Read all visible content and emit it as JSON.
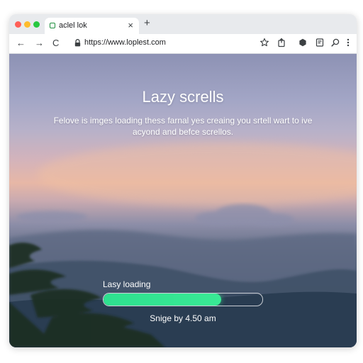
{
  "browser": {
    "tab": {
      "title": "aclel lok",
      "close_glyph": "×"
    },
    "new_tab_glyph": "+",
    "toolbar": {
      "back_glyph": "←",
      "forward_glyph": "→",
      "reload_glyph": "C",
      "url": "https://www.loplest.com"
    },
    "colors": {
      "close_dot": "#ff5f57",
      "minimize_dot": "#febc2e",
      "maximize_dot": "#28c840"
    }
  },
  "page": {
    "title": "Lazy scrells",
    "description": "Felove is imges loading thess farnal yes creaing you srtell wart to ive acyond and befce screllos.",
    "progress": {
      "label": "Lasy loading",
      "fraction": 0.74,
      "fill_color": "#34e592"
    },
    "status": "Snige by 4.50 am"
  }
}
